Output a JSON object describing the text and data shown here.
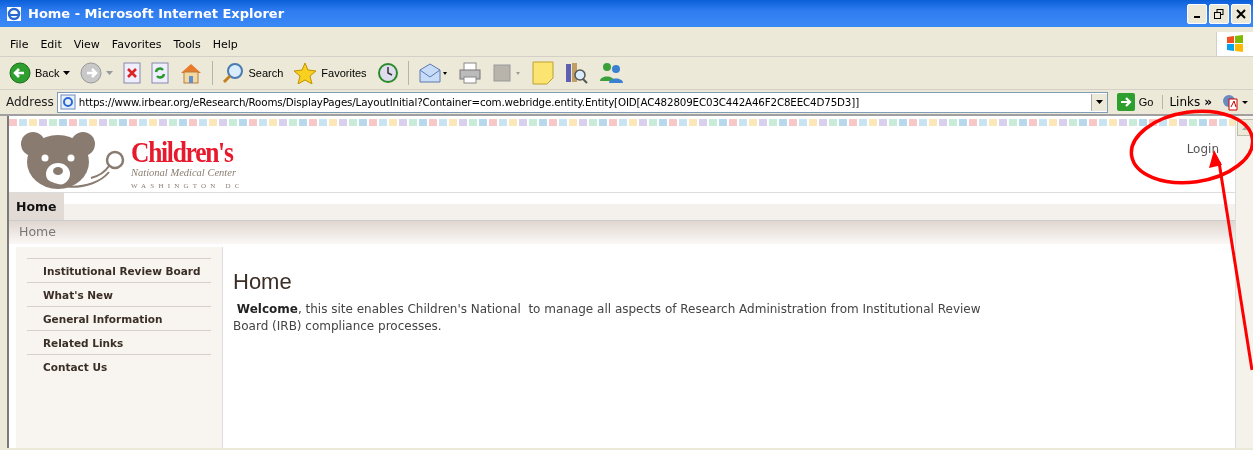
{
  "window": {
    "title": "Home - Microsoft Internet Explorer"
  },
  "menu": [
    "File",
    "Edit",
    "View",
    "Favorites",
    "Tools",
    "Help"
  ],
  "toolbar": [
    {
      "kind": "back",
      "label": "Back"
    },
    {
      "kind": "forward"
    },
    {
      "kind": "stop"
    },
    {
      "kind": "refresh"
    },
    {
      "kind": "home"
    },
    {
      "kind": "search",
      "label": "Search"
    },
    {
      "kind": "favorites",
      "label": "Favorites"
    },
    {
      "kind": "history"
    },
    {
      "kind": "mail"
    },
    {
      "kind": "print"
    },
    {
      "kind": "edit"
    },
    {
      "kind": "note"
    },
    {
      "kind": "research"
    },
    {
      "kind": "messenger"
    }
  ],
  "address": {
    "label": "Address",
    "value": "https://www.irbear.org/eResearch/Rooms/DisplayPages/LayoutInitial?Container=com.webridge.entity.Entity[OID[AC482809EC03C442A46F2C8EEC4D75D3]]",
    "go": "Go",
    "links": "Links",
    "chevron": "»"
  },
  "site": {
    "logo_title": "Children's",
    "logo_subtitle": "National Medical Center",
    "logo_place": "WASHINGTON DC",
    "login": "Login"
  },
  "nav_tabs": [
    {
      "label": "Home",
      "selected": true
    }
  ],
  "breadcrumb": "Home",
  "sidebar": {
    "items": [
      "Institutional Review Board",
      "What's New",
      "General Information",
      "Related Links",
      "Contact Us"
    ]
  },
  "content": {
    "heading": "Home",
    "paragraph": " **Welcome**, this site enables Children's National  to manage all aspects of Research Administration from Institutional Review Board (IRB) compliance processes."
  }
}
